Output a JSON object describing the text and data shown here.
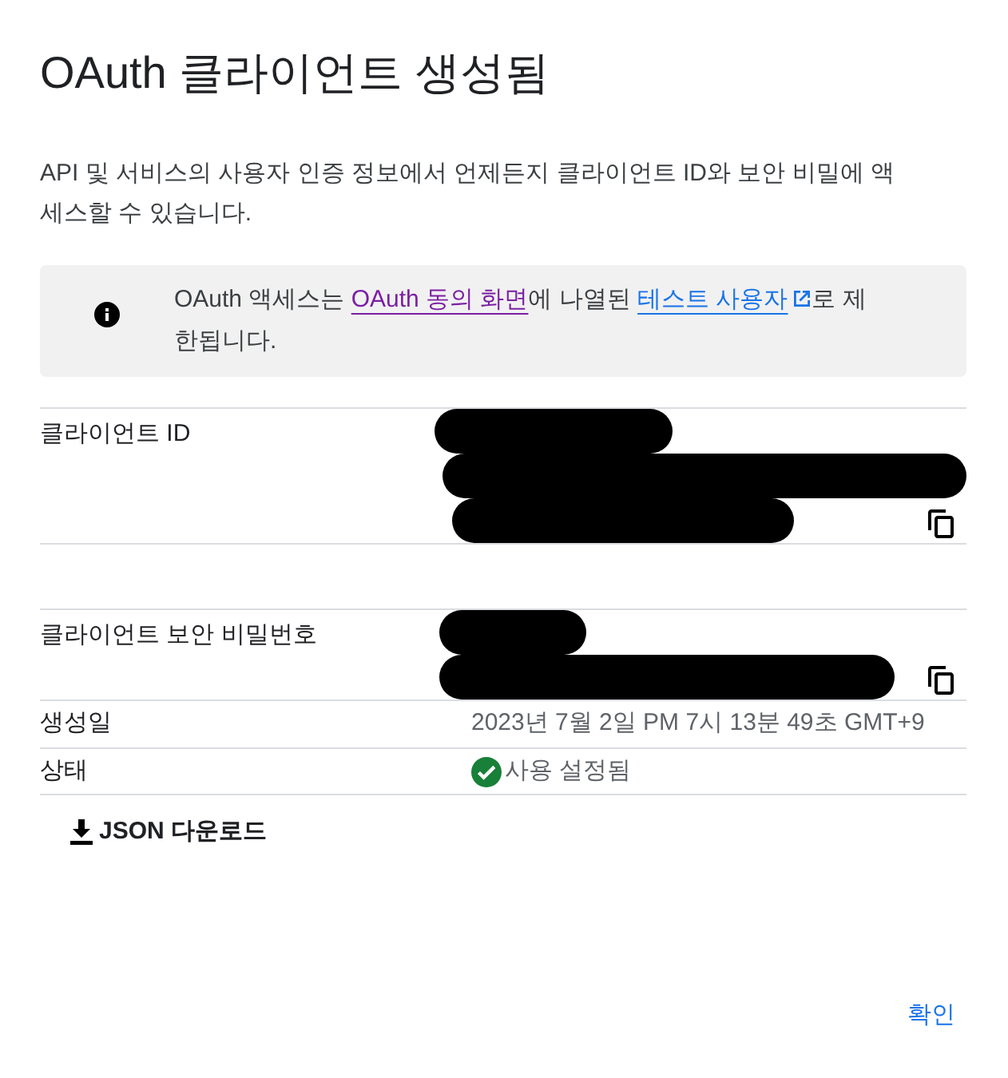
{
  "dialog": {
    "title": "OAuth 클라이언트 생성됨",
    "description": "API 및 서비스의 사용자 인증 정보에서 언제든지 클라이언트 ID와 보안 비밀에 액세스할 수 있습니다.",
    "notice": [
      {
        "kind": "text",
        "text": "OAuth 액세스는 "
      },
      {
        "kind": "link",
        "text": "OAuth 동의 화면",
        "visited": true
      },
      {
        "kind": "text",
        "text": "에 나열된 "
      },
      {
        "kind": "external_link",
        "text": "테스트 사용자",
        "visited": false
      },
      {
        "kind": "text",
        "text": "로 제한됩니다."
      }
    ],
    "credentials": [
      {
        "label": "클라이언트 ID",
        "redacted": true,
        "copyable": true
      },
      {
        "label": "클라이언트 보안 비밀번호",
        "redacted": true,
        "copyable": true
      }
    ],
    "details": [
      {
        "kind": "text",
        "label": "생성일",
        "value": "2023년 7월 2일 PM 7시 13분 49초 GMT+9"
      },
      {
        "kind": "status",
        "label": "상태",
        "value": "사용 설정됨",
        "enabled": true
      }
    ],
    "download_button": "JSON 다운로드",
    "confirm_button": "확인"
  }
}
